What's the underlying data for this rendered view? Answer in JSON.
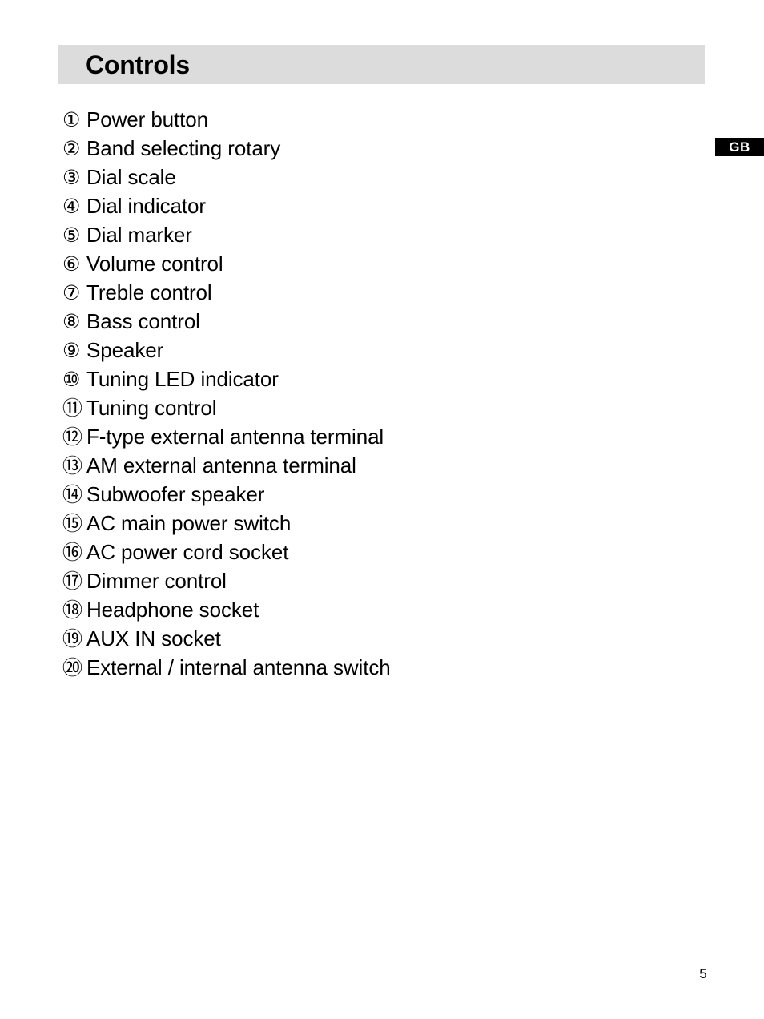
{
  "page": {
    "background": "#ffffff",
    "number": "5"
  },
  "header": {
    "title": "Controls",
    "background": "#dcdcdd"
  },
  "language_badge": {
    "label": "GB",
    "background": "#000000",
    "color": "#ffffff"
  },
  "controls": {
    "items": [
      {
        "number": "①",
        "label": "Power button"
      },
      {
        "number": "②",
        "label": "Band selecting rotary"
      },
      {
        "number": "③",
        "label": "Dial scale"
      },
      {
        "number": "④",
        "label": "Dial indicator"
      },
      {
        "number": "⑤",
        "label": "Dial marker"
      },
      {
        "number": "⑥",
        "label": "Volume control"
      },
      {
        "number": "⑦",
        "label": "Treble control"
      },
      {
        "number": "⑧",
        "label": "Bass control"
      },
      {
        "number": "⑨",
        "label": "Speaker"
      },
      {
        "number": "⑩",
        "label": "Tuning LED indicator"
      },
      {
        "number": "⑪",
        "label": "Tuning control"
      },
      {
        "number": "⑫",
        "label": "F-type external antenna terminal"
      },
      {
        "number": "⑬",
        "label": "AM external antenna terminal"
      },
      {
        "number": "⑭",
        "label": "Subwoofer speaker"
      },
      {
        "number": "⑮",
        "label": "AC main power switch"
      },
      {
        "number": "⑯",
        "label": "AC power cord socket"
      },
      {
        "number": "⑰",
        "label": "Dimmer control"
      },
      {
        "number": "⑱",
        "label": "Headphone socket"
      },
      {
        "number": "⑲",
        "label": "AUX IN socket"
      },
      {
        "number": "⑳",
        "label": "External / internal antenna switch"
      }
    ]
  }
}
